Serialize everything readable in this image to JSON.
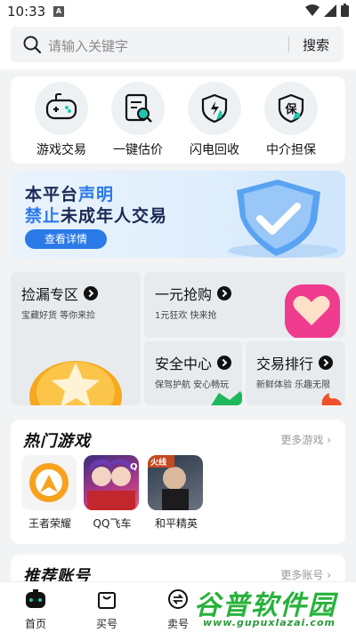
{
  "status_bar": {
    "time": "10:33",
    "notif_letter": "A"
  },
  "search": {
    "placeholder": "请输入关键字",
    "button": "搜索"
  },
  "quick_actions": [
    {
      "label": "游戏交易",
      "icon": "gamepad-icon"
    },
    {
      "label": "一键估价",
      "icon": "appraisal-icon"
    },
    {
      "label": "闪电回收",
      "icon": "lightning-shield-icon"
    },
    {
      "label": "中介担保",
      "icon": "guarantee-shield-icon"
    }
  ],
  "banner": {
    "line1_a": "本平台",
    "line1_b": "声明",
    "line2_a": "禁止",
    "line2_b": "未成年人交易",
    "button": "查看详情"
  },
  "feature_cards": [
    {
      "title": "捡漏专区",
      "subtitle": "宝藏好货 等你来捡"
    },
    {
      "title": "一元抢购",
      "subtitle": "1元狂欢 快来抢"
    },
    {
      "title": "安全中心",
      "subtitle": "保驾护航 安心畅玩"
    },
    {
      "title": "交易排行",
      "subtitle": "新鲜体验 乐趣无限"
    }
  ],
  "hot_games": {
    "title": "热门游戏",
    "more": "更多游戏 ›",
    "games": [
      {
        "name": "王者荣耀"
      },
      {
        "name": "QQ飞车"
      },
      {
        "name": "和平精英"
      }
    ],
    "game_badge": "火线",
    "icon_letter": "Q"
  },
  "recommended": {
    "title": "推荐账号",
    "more": "更多账号 ›"
  },
  "tabbar": [
    {
      "label": "首页",
      "icon": "home-icon"
    },
    {
      "label": "买号",
      "icon": "shopping-bag-icon"
    },
    {
      "label": "卖号",
      "icon": "sell-icon"
    }
  ],
  "watermark": {
    "main": "谷普软件园",
    "url": "www.gupuxlazai.com"
  },
  "colors": {
    "accent": "#2a7ae8",
    "teal": "#1fc7b0",
    "watermark": "#27b23a"
  }
}
